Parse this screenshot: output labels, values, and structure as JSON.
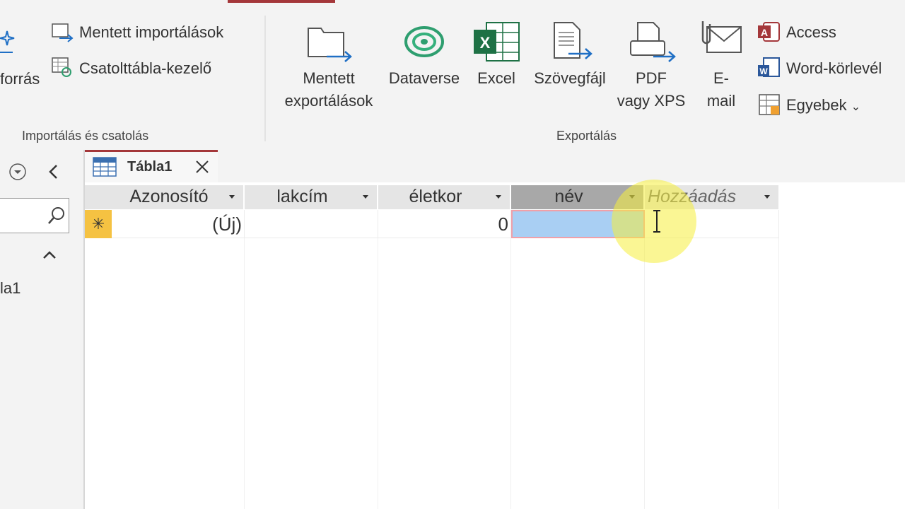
{
  "ribbon": {
    "import_group": {
      "partial_source_label": "forrás",
      "saved_imports_label": "Mentett importálások",
      "linked_table_manager_label": "Csatolttábla-kezelő",
      "group_label": "Importálás és csatolás"
    },
    "export_group": {
      "saved_exports_line1": "Mentett",
      "saved_exports_line2": "exportálások",
      "dataverse_label": "Dataverse",
      "excel_label": "Excel",
      "text_file_label": "Szövegfájl",
      "pdf_line1": "PDF",
      "pdf_line2": "vagy XPS",
      "email_line1": "E-",
      "email_line2": "mail",
      "access_label": "Access",
      "word_merge_label": "Word-körlevél",
      "more_label": "Egyebek",
      "group_label": "Exportálás"
    }
  },
  "nav_pane": {
    "partial_item_label": "la1"
  },
  "document_tab": {
    "title": "Tábla1"
  },
  "datasheet": {
    "columns": [
      "Azonosító",
      "lakcím",
      "életkor",
      "név",
      "Hozzáadás"
    ],
    "new_row": {
      "marker": "✳",
      "id_value": "(Új)",
      "address_value": "",
      "age_value": "0",
      "name_value": ""
    }
  },
  "colors": {
    "accent": "#a4373a",
    "excel_green": "#1e7145",
    "dataverse_green": "#2e9e6f",
    "access_red": "#a4373a",
    "word_blue": "#2b579a",
    "selected_cell": "#a9cff3",
    "highlight_yellow": "#f5ef5a"
  }
}
